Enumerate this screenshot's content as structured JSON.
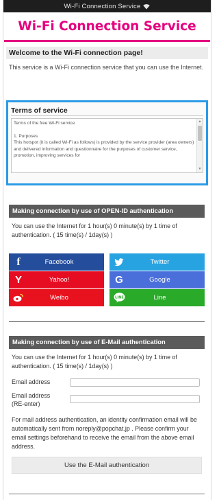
{
  "status_bar": {
    "text": "Wi-Fi Connection Service",
    "icon": "wifi-icon"
  },
  "header": {
    "title": "Wi-Fi Connection Service",
    "brand_color": "#e5007f"
  },
  "welcome": {
    "heading": "Welcome to the Wi-Fi connection page!",
    "body": "This service is a Wi-Fi connection service that you can use the Internet."
  },
  "terms": {
    "heading": "Terms of service",
    "text": "Terms of the free Wi-Fi service\n\n1. Purposes\nThis hotspot (it is called Wi-Fi as follows) is provided by the service provider (area owners) and delivered information and questionnaire for the purposes of customer service, promotion, improving services for"
  },
  "openid": {
    "heading": "Making connection by use of OPEN-ID authentication",
    "text": "You can use the Internet for 1 hour(s) 0 minute(s) by 1 time of authentication. ( 15 time(s) / 1day(s) )",
    "buttons": [
      {
        "label": "Facebook",
        "icon": "facebook-icon",
        "color": "#244e9c"
      },
      {
        "label": "Twitter",
        "icon": "twitter-icon",
        "color": "#27a3e2"
      },
      {
        "label": "Yahoo!",
        "icon": "yahoo-icon",
        "color": "#e60d22"
      },
      {
        "label": "Google",
        "icon": "google-icon",
        "color": "#4b6fda"
      },
      {
        "label": "Weibo",
        "icon": "weibo-icon",
        "color": "#e8121f"
      },
      {
        "label": "Line",
        "icon": "line-icon",
        "color": "#2aaa29"
      }
    ]
  },
  "email": {
    "heading": "Making connection by use of E-Mail authentication",
    "text": "You can use the Internet for 1 hour(s) 0 minute(s) by 1 time of authentication. ( 15 time(s) / 1day(s) )",
    "email_label": "Email address",
    "email_value": "",
    "reenter_label_1": "Email address",
    "reenter_label_2": "(RE-enter)",
    "reenter_value": "",
    "note": "For mail address authentication, an identity confirmation email will be automatically sent from noreply@popchat.jp . Please confirm your email settings beforehand to receive the email from the above email address.",
    "button": "Use the E-Mail authentication"
  }
}
